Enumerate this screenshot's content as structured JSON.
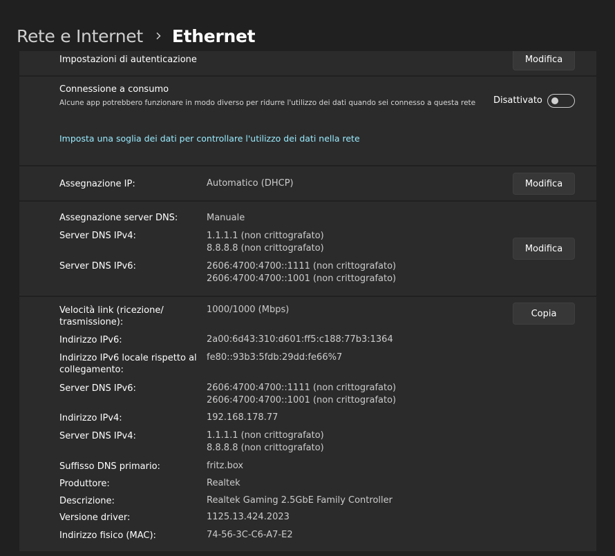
{
  "breadcrumb": {
    "parent": "Rete e Internet",
    "current": "Ethernet"
  },
  "auth": {
    "label": "Impostazioni di autenticazione",
    "button": "Modifica"
  },
  "metered": {
    "title": "Connessione a consumo",
    "description": "Alcune app potrebbero funzionare in modo diverso per ridurre l'utilizzo dei dati quando sei connesso a questa rete",
    "toggle_state": "Disattivato",
    "link": "Imposta una soglia dei dati per controllare l'utilizzo dei dati nella rete"
  },
  "ip": {
    "label": "Assegnazione IP:",
    "value": "Automatico (DHCP)",
    "button": "Modifica"
  },
  "dns": {
    "assignment_label": "Assegnazione server DNS:",
    "assignment_value": "Manuale",
    "ipv4_label": "Server DNS IPv4:",
    "ipv4_values": [
      "1.1.1.1 (non crittografato)",
      "8.8.8.8 (non crittografato)"
    ],
    "ipv6_label": "Server DNS IPv6:",
    "ipv6_values": [
      "2606:4700:4700::1111 (non crittografato)",
      "2606:4700:4700::1001 (non crittografato)"
    ],
    "button": "Modifica"
  },
  "properties": {
    "button": "Copia",
    "rows": [
      {
        "label": "Velocità link (ricezione/\ntrasmissione):",
        "values": [
          "1000/1000 (Mbps)"
        ]
      },
      {
        "label": "Indirizzo IPv6:",
        "values": [
          "2a00:6d43:310:d601:ff5:c188:77b3:1364"
        ]
      },
      {
        "label": "Indirizzo IPv6 locale rispetto al\ncollegamento:",
        "values": [
          "fe80::93b3:5fdb:29dd:fe66%7"
        ]
      },
      {
        "label": "Server DNS IPv6:",
        "values": [
          "2606:4700:4700::1111 (non crittografato)",
          "2606:4700:4700::1001 (non crittografato)"
        ]
      },
      {
        "label": "Indirizzo IPv4:",
        "values": [
          "192.168.178.77"
        ]
      },
      {
        "label": "Server DNS IPv4:",
        "values": [
          "1.1.1.1 (non crittografato)",
          "8.8.8.8 (non crittografato)"
        ]
      },
      {
        "label": "Suffisso DNS primario:",
        "values": [
          "fritz.box"
        ]
      },
      {
        "label": "Produttore:",
        "values": [
          "Realtek"
        ]
      },
      {
        "label": "Descrizione:",
        "values": [
          "Realtek Gaming 2.5GbE Family Controller"
        ]
      },
      {
        "label": "Versione driver:",
        "values": [
          "1125.13.424.2023"
        ]
      },
      {
        "label": "Indirizzo fisico (MAC):",
        "values": [
          "74-56-3C-C6-A7-E2"
        ]
      }
    ]
  }
}
